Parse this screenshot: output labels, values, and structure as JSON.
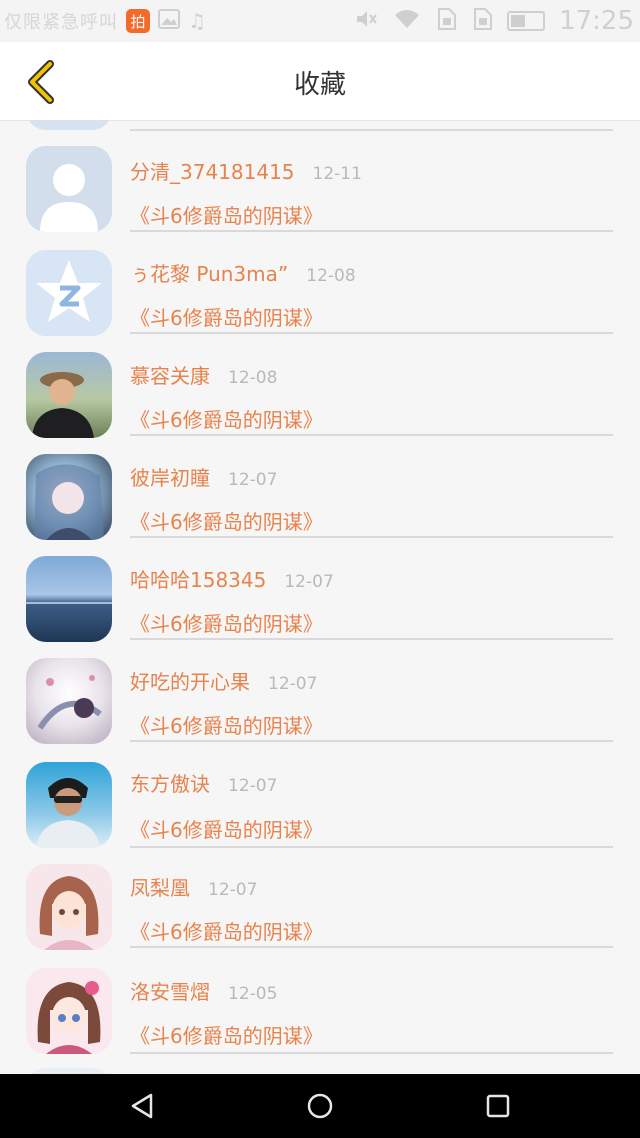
{
  "status_bar": {
    "carrier": "仅限紧急呼叫",
    "app_badge": "拍",
    "time": "17:25",
    "icons": [
      "app-icon",
      "image-icon",
      "music-icon",
      "mute-icon",
      "wifi-icon",
      "sim-icon",
      "sim2-icon",
      "battery-icon"
    ]
  },
  "header": {
    "title": "收藏",
    "back_icon": "chevron-left-icon"
  },
  "favorites": [
    {
      "name": "分清_374181415",
      "date": "12-11",
      "work": "《斗6修爵岛的阴谋》",
      "avatar": "default-person-avatar"
    },
    {
      "name": "ぅ花黎 Pun3ma”",
      "date": "12-08",
      "work": "《斗6修爵岛的阴谋》",
      "avatar": "qq-star-avatar"
    },
    {
      "name": "慕容关康",
      "date": "12-08",
      "work": "《斗6修爵岛的阴谋》",
      "avatar": "photo-avatar"
    },
    {
      "name": "彼岸初瞳",
      "date": "12-07",
      "work": "《斗6修爵岛的阴谋》",
      "avatar": "anime-avatar"
    },
    {
      "name": "哈哈哈158345",
      "date": "12-07",
      "work": "《斗6修爵岛的阴谋》",
      "avatar": "sea-avatar"
    },
    {
      "name": "好吃的开心果",
      "date": "12-07",
      "work": "《斗6修爵岛的阴谋》",
      "avatar": "anime-avatar"
    },
    {
      "name": "东方傲诀",
      "date": "12-07",
      "work": "《斗6修爵岛的阴谋》",
      "avatar": "photo-avatar"
    },
    {
      "name": "凤梨凰",
      "date": "12-07",
      "work": "《斗6修爵岛的阴谋》",
      "avatar": "anime-avatar"
    },
    {
      "name": "洛安雪熠",
      "date": "12-05",
      "work": "《斗6修爵岛的阴谋》",
      "avatar": "anime-avatar"
    }
  ],
  "colors": {
    "accent": "#e8834d",
    "date_gray": "#b9b9b9",
    "back_arrow": "#f2c400",
    "background": "#f6f6f6"
  },
  "nav_bar": {
    "icons": [
      "back-triangle-icon",
      "home-circle-icon",
      "recents-square-icon"
    ]
  }
}
